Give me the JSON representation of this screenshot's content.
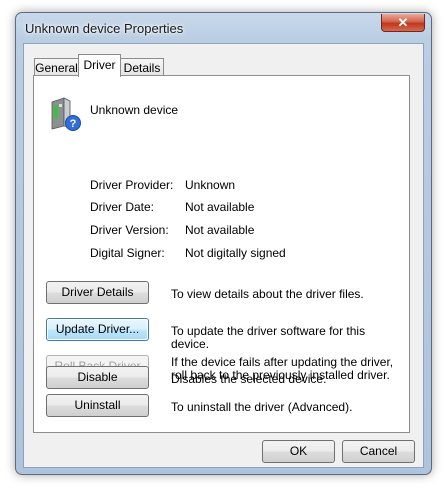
{
  "window": {
    "title": "Unknown device Properties",
    "close_glyph": "✕"
  },
  "tabs": [
    {
      "label": "General",
      "active": false
    },
    {
      "label": "Driver",
      "active": true
    },
    {
      "label": "Details",
      "active": false
    }
  ],
  "device": {
    "icon": "unknown-device-icon",
    "name": "Unknown device"
  },
  "properties": [
    {
      "label": "Driver Provider:",
      "value": "Unknown"
    },
    {
      "label": "Driver Date:",
      "value": "Not available"
    },
    {
      "label": "Driver Version:",
      "value": "Not available"
    },
    {
      "label": "Digital Signer:",
      "value": "Not digitally signed"
    }
  ],
  "actions": [
    {
      "label": "Driver Details",
      "description": "To view details about the driver files.",
      "enabled": true
    },
    {
      "label": "Update Driver...",
      "description": "To update the driver software for this device.",
      "enabled": true,
      "focused": true
    },
    {
      "label": "Roll Back Driver",
      "description": "If the device fails after updating the driver, roll back to the previously installed driver.",
      "enabled": false
    },
    {
      "label": "Disable",
      "description": "Disables the selected device.",
      "enabled": true
    },
    {
      "label": "Uninstall",
      "description": "To uninstall the driver (Advanced).",
      "enabled": true
    }
  ],
  "footer": {
    "ok_label": "OK",
    "cancel_label": "Cancel"
  },
  "colors": {
    "title_bar": "#b9cde3",
    "close_button": "#c0361e",
    "focused_button": "#bee6fd"
  }
}
